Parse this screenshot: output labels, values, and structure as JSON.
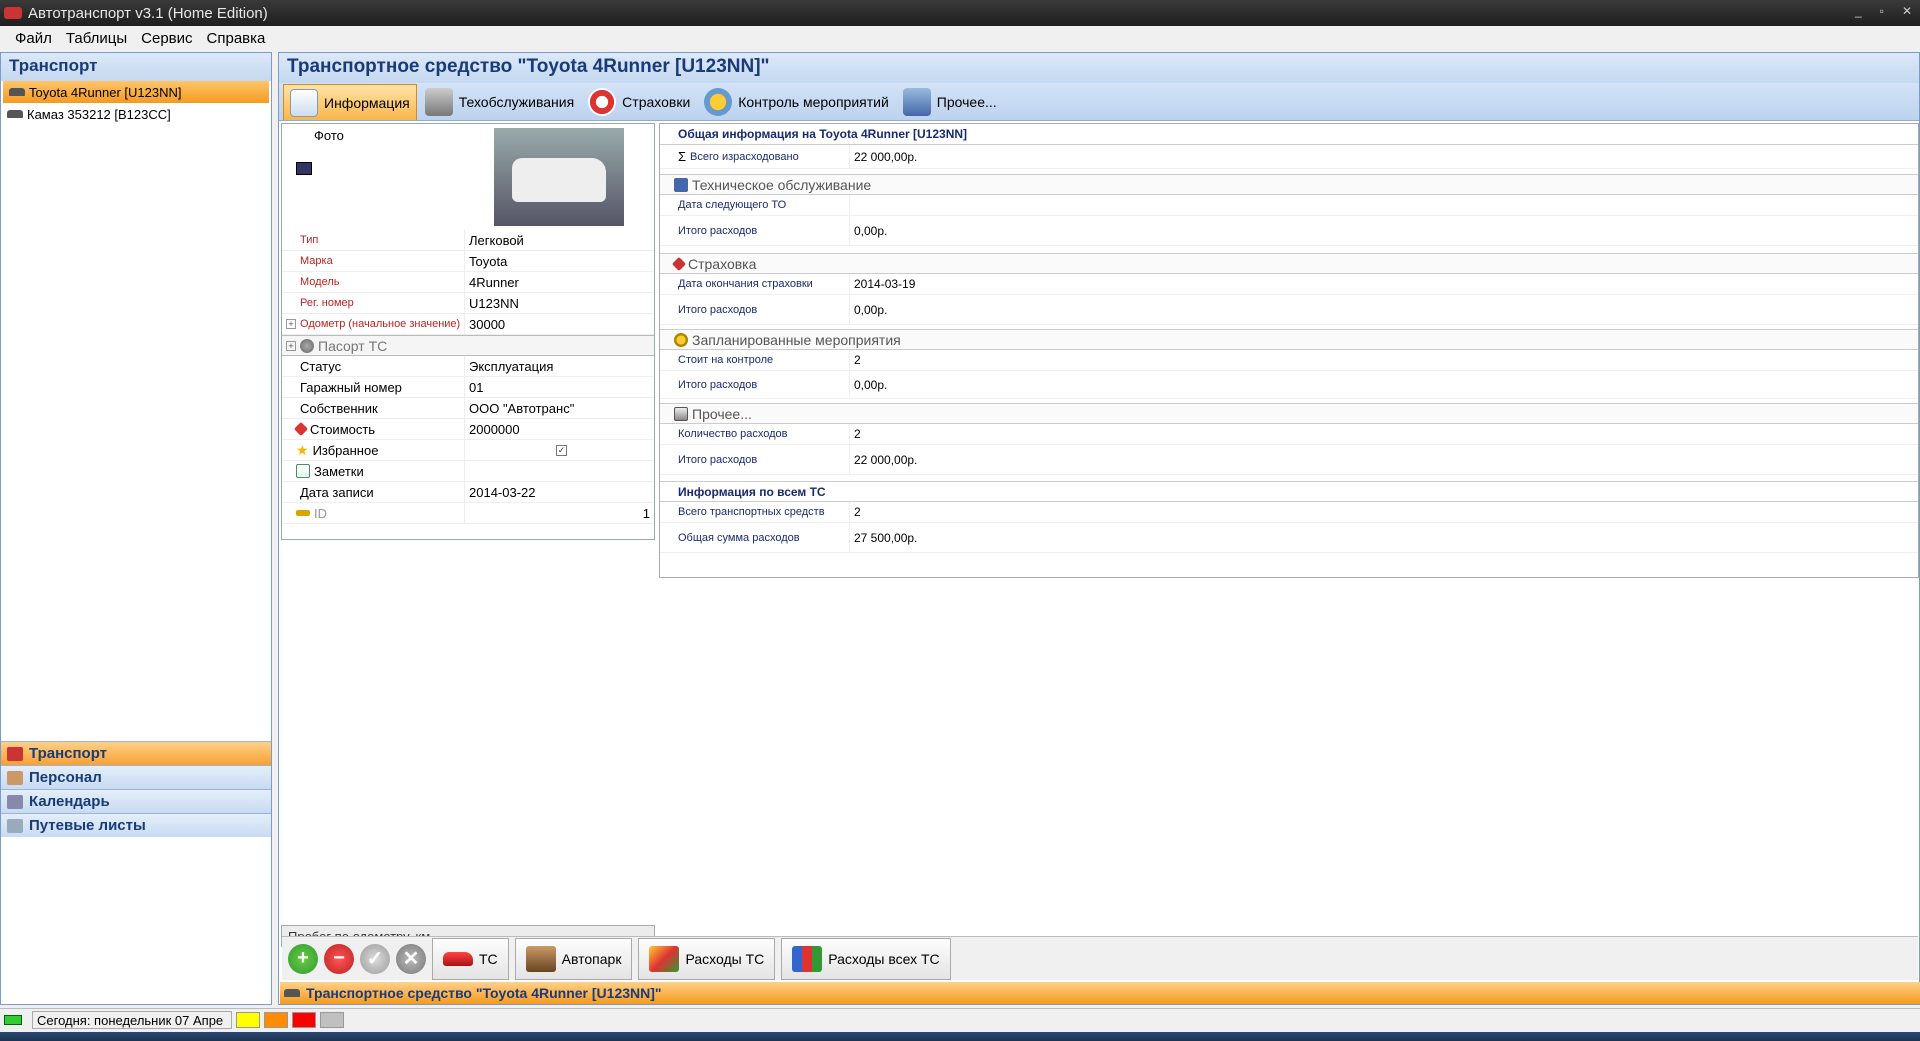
{
  "window": {
    "title": "Автотранспорт v3.1 (Home Edition)",
    "controls": [
      "_",
      "▫",
      "✕"
    ]
  },
  "menu": [
    "Файл",
    "Таблицы",
    "Сервис",
    "Справка"
  ],
  "left_panel": {
    "title": "Транспорт",
    "tree": [
      {
        "label": "Toyota 4Runner [U123NN]",
        "selected": true
      },
      {
        "label": "Камаз 353212 [В123СС]",
        "selected": false
      }
    ],
    "nav_groups": [
      {
        "label": "Транспорт",
        "active": true
      },
      {
        "label": "Персонал",
        "active": false
      },
      {
        "label": "Календарь",
        "active": false
      },
      {
        "label": "Путевые листы",
        "active": false
      }
    ]
  },
  "main": {
    "title": "Транспортное средство \"Toyota 4Runner [U123NN]\"",
    "tabs": [
      {
        "label": "Информация",
        "icon": "info-card-icon"
      },
      {
        "label": "Техобслуживания",
        "icon": "wrench-icon"
      },
      {
        "label": "Страховки",
        "icon": "lifebuoy-icon"
      },
      {
        "label": "Контроль мероприятий",
        "icon": "gears-icon"
      },
      {
        "label": "Прочее...",
        "icon": "misc-icon"
      }
    ]
  },
  "properties": {
    "photo_label": "Фото",
    "rows_red": [
      {
        "label": "Тип",
        "value": "Легковой"
      },
      {
        "label": "Марка",
        "value": "Toyota"
      },
      {
        "label": "Модель",
        "value": "4Runner"
      },
      {
        "label": "Рег. номер",
        "value": "U123NN"
      },
      {
        "label": "Одометр (начальное значение)",
        "value": "30000"
      }
    ],
    "group_passport": "Пасорт ТС",
    "rows": [
      {
        "label": "Статус",
        "value": "Эксплуатация"
      },
      {
        "label": "Гаражный номер",
        "value": "01"
      },
      {
        "label": "Собственник",
        "value": "ООО \"Автотранс\""
      },
      {
        "label": "Стоимость",
        "value": "2000000"
      },
      {
        "label": "Избранное",
        "value": ""
      },
      {
        "label": "Заметки",
        "value": ""
      },
      {
        "label": "Дата записи",
        "value": "2014-03-22"
      },
      {
        "label": "ID",
        "value": "1"
      }
    ],
    "favorite_checked": true,
    "odometer_label": "Пробег по одометру, км",
    "odometer_value": "30000"
  },
  "info": {
    "general_header": "Общая информация на Toyota 4Runner [U123NN]",
    "total_spent_label": "Всего израсходовано",
    "total_spent_value": "22 000,00р.",
    "sections": [
      {
        "title": "Техническое обслуживание",
        "rows": [
          {
            "label": "Дата следующего ТО",
            "value": ""
          },
          {
            "label": "Итого расходов",
            "value": "0,00р."
          }
        ]
      },
      {
        "title": "Страховка",
        "rows": [
          {
            "label": "Дата окончания страховки",
            "value": "2014-03-19"
          },
          {
            "label": "Итого расходов",
            "value": "0,00р."
          }
        ]
      },
      {
        "title": "Запланированные мероприятия",
        "rows": [
          {
            "label": "Стоит на контроле",
            "value": "2"
          },
          {
            "label": "Итого расходов",
            "value": "0,00р."
          }
        ]
      },
      {
        "title": "Прочее...",
        "rows": [
          {
            "label": "Количество расходов",
            "value": "2"
          },
          {
            "label": "Итого расходов",
            "value": "22 000,00р."
          }
        ]
      }
    ],
    "all_header": "Информация по всем ТС",
    "all_rows": [
      {
        "label": "Всего  транспортных средств",
        "value": "2"
      },
      {
        "label": "Общая сумма расходов",
        "value": "27 500,00р."
      }
    ]
  },
  "toolbar": {
    "buttons": [
      {
        "label": "ТС",
        "icon": "red-car-icon"
      },
      {
        "label": "Автопарк",
        "icon": "garage-icon"
      },
      {
        "label": "Расходы ТС",
        "icon": "cube-icon"
      },
      {
        "label": "Расходы всех ТС",
        "icon": "bar-chart-icon"
      }
    ]
  },
  "status_orange": "Транспортное средство \"Toyota 4Runner [U123NN]\"",
  "statusbar": {
    "today": "Сегодня: понедельник 07 Апре"
  },
  "colors": {
    "accent_orange": "#f59a20",
    "header_blue": "#1a3a78",
    "swatches": [
      "#ffff00",
      "#ff8c00",
      "#ff0000",
      "#c0c0c0"
    ]
  }
}
